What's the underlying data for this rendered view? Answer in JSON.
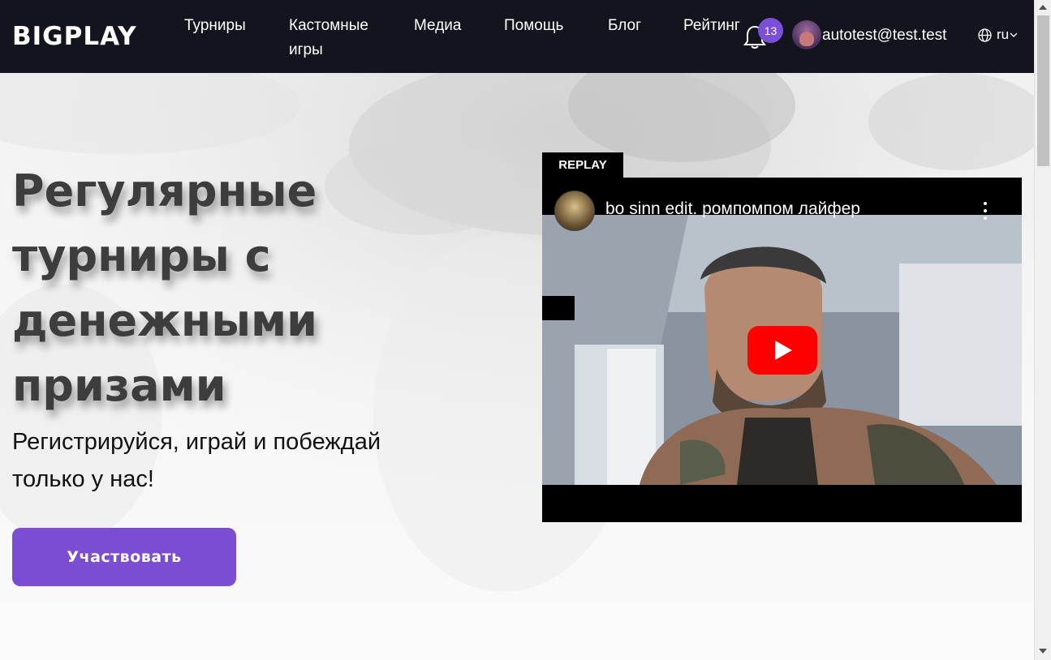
{
  "header": {
    "logo": "BIGPLAY",
    "nav": [
      {
        "label": "Турниры"
      },
      {
        "label": "Кастомные игры"
      },
      {
        "label": "Медиа"
      },
      {
        "label": "Помощь"
      },
      {
        "label": "Блог"
      },
      {
        "label": "Рейтинг"
      }
    ],
    "notifications_count": "13",
    "user_email": "autotest@test.test",
    "language": "ru"
  },
  "hero": {
    "title": "Регулярные турниры с денежными призами",
    "subtitle": "Регистрируйся, играй и побеждай только у нас!",
    "cta_label": "Участвовать"
  },
  "video": {
    "tab_label": "REPLAY",
    "title": "bo sinn edit. ромпомпом лайфер"
  },
  "colors": {
    "header_bg": "#14141f",
    "accent": "#7c4dd3",
    "badge": "#7b4fd6",
    "youtube_red": "#ff0000"
  }
}
